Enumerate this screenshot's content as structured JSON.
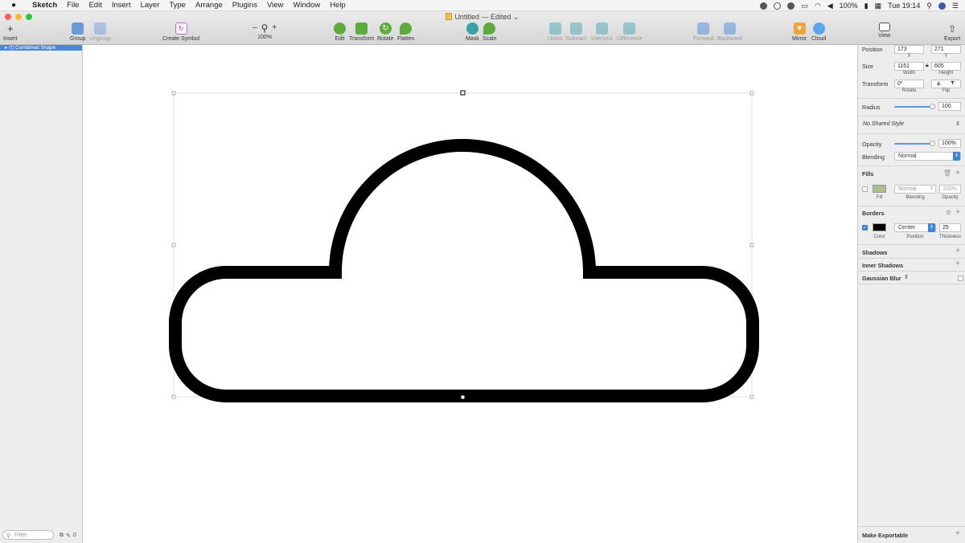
{
  "menu": {
    "apple": "",
    "app": "Sketch",
    "items": [
      "File",
      "Edit",
      "Insert",
      "Layer",
      "Type",
      "Arrange",
      "Plugins",
      "View",
      "Window",
      "Help"
    ],
    "battery": "100%",
    "clock": "Tue 19:14"
  },
  "window": {
    "title": "Untitled — Edited",
    "colors": {
      "close": "#fc5f57",
      "minimize": "#fdbc2e",
      "zoom": "#28c840"
    }
  },
  "toolbar": {
    "insert": "Insert",
    "group": "Group",
    "ungroup": "Ungroup",
    "create_symbol": "Create Symbol",
    "zoom_minus": "–",
    "zoom_plus": "+",
    "zoom": "100%",
    "edit": "Edit",
    "transform": "Transform",
    "rotate": "Rotate",
    "flatten": "Flatten",
    "mask": "Mask",
    "scale": "Scale",
    "union": "Union",
    "subtract": "Subtract",
    "intersect": "Intersect",
    "difference": "Difference",
    "forward": "Forward",
    "backward": "Backward",
    "mirror": "Mirror",
    "cloud": "Cloud",
    "view": "View",
    "export": "Export"
  },
  "layers": {
    "selected_layer": "Combined Shape",
    "filter_placeholder": "Filter",
    "edit_count": "0"
  },
  "inspector": {
    "position_label": "Position",
    "x": "173",
    "y": "271",
    "x_label": "X",
    "y_label": "Y",
    "size_label": "Size",
    "width": "1151",
    "height": "605",
    "width_label": "Width",
    "height_label": "Height",
    "transform_label": "Transform",
    "rotate": "0°",
    "rotate_label": "Rotate",
    "flip_label": "Flip",
    "radius_label": "Radius",
    "radius": "100",
    "radius_fraction": 1.0,
    "shared_style": "No Shared Style",
    "opacity_label": "Opacity",
    "opacity": "100%",
    "opacity_fraction": 1.0,
    "blending_label": "Blending",
    "blending": "Normal",
    "fills_title": "Fills",
    "fill_blending": "Normal",
    "fill_opacity": "100%",
    "fill_label": "Fill",
    "fill_blending_label": "Blending",
    "fill_opacity_label": "Opacity",
    "fill_color": "#a9bf8f",
    "fill_enabled": false,
    "borders_title": "Borders",
    "border_position": "Center",
    "border_thickness": "25",
    "border_color_label": "Color",
    "border_position_label": "Position",
    "border_thickness_label": "Thickness",
    "border_color": "#000000",
    "border_enabled": true,
    "shadows_title": "Shadows",
    "inner_shadows_title": "Inner Shadows",
    "gaussian_blur_title": "Gaussian Blur",
    "make_exportable": "Make Exportable"
  }
}
